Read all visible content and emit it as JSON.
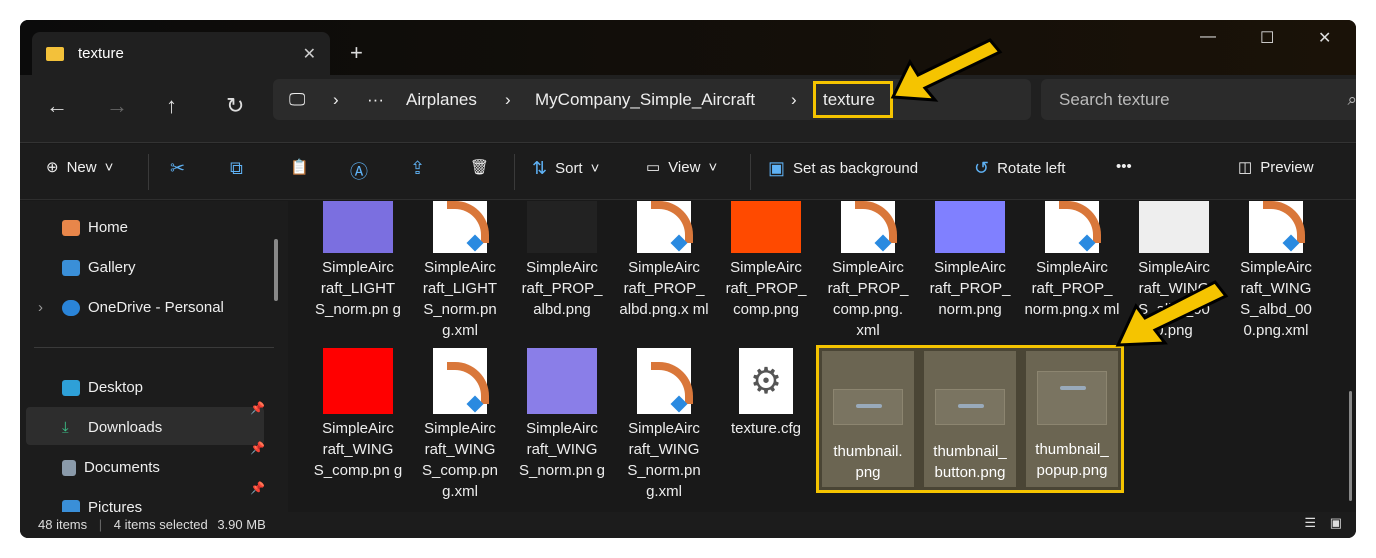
{
  "tab": {
    "title": "texture"
  },
  "address": {
    "segments": [
      "Airplanes",
      "MyCompany_Simple_Aircraft",
      "texture"
    ],
    "search_placeholder": "Search texture"
  },
  "toolbar": {
    "new": "New",
    "sort": "Sort",
    "view": "View",
    "set_bg": "Set as background",
    "rotate": "Rotate left",
    "more": "•••",
    "preview": "Preview"
  },
  "sidebar": {
    "items": [
      "Home",
      "Gallery",
      "OneDrive - Personal",
      "Desktop",
      "Downloads",
      "Documents",
      "Pictures"
    ]
  },
  "files": [
    {
      "name": "SimpleAircraft_LIGHTS_norm.png",
      "label": "SimpleAirc raft_LIGHT S_norm.pn g",
      "thumb": "#7b6fe0"
    },
    {
      "name": "SimpleAircraft_LIGHTS_norm.png.xml",
      "label": "SimpleAirc raft_LIGHT S_norm.pn g.xml",
      "thumb": "doc"
    },
    {
      "name": "SimpleAircraft_PROP_albd.png",
      "label": "SimpleAirc raft_PROP_ albd.png",
      "thumb": "#222"
    },
    {
      "name": "SimpleAircraft_PROP_albd.png.xml",
      "label": "SimpleAirc raft_PROP_ albd.png.x ml",
      "thumb": "doc"
    },
    {
      "name": "SimpleAircraft_PROP_comp.png",
      "label": "SimpleAirc raft_PROP_ comp.png",
      "thumb": "#ff4a00"
    },
    {
      "name": "SimpleAircraft_PROP_comp.png.xml",
      "label": "SimpleAirc raft_PROP_ comp.png. xml",
      "thumb": "doc"
    },
    {
      "name": "SimpleAircraft_PROP_norm.png",
      "label": "SimpleAirc raft_PROP_ norm.png",
      "thumb": "#8080ff"
    },
    {
      "name": "SimpleAircraft_PROP_norm.png.xml",
      "label": "SimpleAirc raft_PROP_ norm.png.x ml",
      "thumb": "doc"
    },
    {
      "name": "SimpleAircraft_WINGS_albd_000.png",
      "label": "SimpleAirc raft_WING S_albd_00 0.png",
      "thumb": "#eee"
    },
    {
      "name": "SimpleAircraft_WINGS_albd_000.png.xml",
      "label": "SimpleAirc raft_WING S_albd_00 0.png.xml",
      "thumb": "doc"
    },
    {
      "name": "SimpleAircraft_WINGS_comp.png",
      "label": "SimpleAirc raft_WING S_comp.pn g",
      "thumb": "#f00"
    },
    {
      "name": "SimpleAircraft_WINGS_comp.png.xml",
      "label": "SimpleAirc raft_WING S_comp.pn g.xml",
      "thumb": "doc"
    },
    {
      "name": "SimpleAircraft_WINGS_norm.png",
      "label": "SimpleAirc raft_WING S_norm.pn g",
      "thumb": "#8a7ee8"
    },
    {
      "name": "SimpleAircraft_WINGS_norm.png.xml",
      "label": "SimpleAirc raft_WING S_norm.pn g.xml",
      "thumb": "doc"
    },
    {
      "name": "texture.cfg",
      "label": "texture.cfg",
      "thumb": "cfg"
    }
  ],
  "selected": [
    {
      "label": "thumbnail. png"
    },
    {
      "label": "thumbnail_ button.png"
    },
    {
      "label": "thumbnail_ popup.png"
    }
  ],
  "status": {
    "count": "48 items",
    "selected": "4 items selected",
    "size": "3.90 MB"
  },
  "colors": {
    "highlight": "#f5c400",
    "accent": "#5fb2f5"
  }
}
